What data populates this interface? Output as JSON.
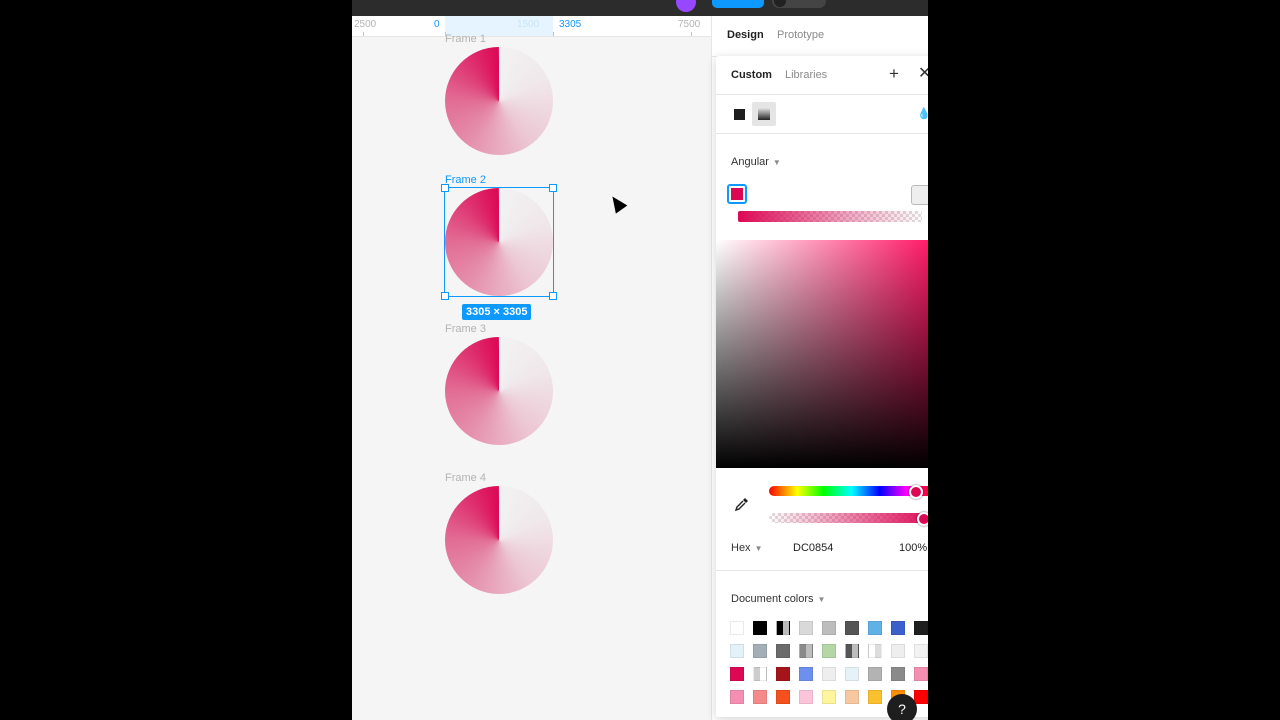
{
  "ruler": {
    "labels": [
      "2500",
      "0",
      "1500",
      "3305",
      "7500"
    ]
  },
  "frames": [
    {
      "label": "Frame 1",
      "selected": false
    },
    {
      "label": "Frame 2",
      "selected": true
    },
    {
      "label": "Frame 3",
      "selected": false
    },
    {
      "label": "Frame 4",
      "selected": false
    }
  ],
  "selection": {
    "size": "3305 × 3305"
  },
  "panel": {
    "tabs": [
      "Design",
      "Prototype"
    ]
  },
  "picker": {
    "tabs": [
      "Custom",
      "Libraries"
    ],
    "plus": "+",
    "close": "✕",
    "gradient_type": "Angular",
    "color_mode": "Hex",
    "hex": "DC0854",
    "opacity": "100%",
    "document_colors_label": "Document colors",
    "stop_colors": [
      "#dc0854",
      "#ffffff"
    ]
  },
  "swatches": [
    [
      "#ffffff",
      "#000000",
      "#000000|#bbbbbb",
      "#d9d9d9",
      "#bdbdbd",
      "#555555",
      "#5fb1e6",
      "#3b5fcb",
      "#1e1e1e"
    ],
    [
      "#e3f1f8",
      "#a3aeb6",
      "#6b6b6b",
      "#8a8a8a|#bdbdbd",
      "#b5d7a8",
      "#555555|#bdbdbd",
      "#ffffff|#dddddd",
      "#eeeeee",
      "#f2f2f2"
    ],
    [
      "#dc0854",
      "#cccccc|#ffffff",
      "#a3151b",
      "#6d8ff0",
      "#eeeeee",
      "#e6f2f8",
      "#b3b3b3",
      "#8a8a8a",
      "#f48fb1"
    ],
    [
      "#f48fb1",
      "#f58a8a",
      "#f4511e",
      "#fcc4d8",
      "#fff59d",
      "#f7c89f",
      "#fbc02d",
      "#ff8f00",
      "#ff0000"
    ]
  ],
  "help": "?"
}
